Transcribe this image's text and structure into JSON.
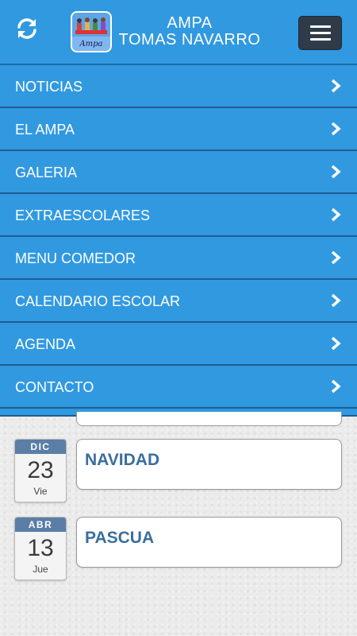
{
  "header": {
    "title_line1": "AMPA",
    "title_line2": "TOMAS NAVARRO",
    "logo_text": "Ampa",
    "refresh_icon": "refresh-icon",
    "menu_icon": "hamburger-icon"
  },
  "menu": {
    "items": [
      {
        "label": "NOTICIAS"
      },
      {
        "label": "EL AMPA"
      },
      {
        "label": "GALERIA"
      },
      {
        "label": "EXTRAESCOLARES"
      },
      {
        "label": "MENU COMEDOR"
      },
      {
        "label": "CALENDARIO ESCOLAR"
      },
      {
        "label": "AGENDA"
      },
      {
        "label": "CONTACTO"
      }
    ]
  },
  "events": [
    {
      "month": "DIC",
      "day": "23",
      "weekday": "Vie",
      "title": "NAVIDAD"
    },
    {
      "month": "ABR",
      "day": "13",
      "weekday": "Jue",
      "title": "PASCUA"
    }
  ],
  "colors": {
    "primary": "#3199e0",
    "menu_button": "#2f3b49",
    "date_header": "#5a7ea6",
    "event_title": "#3a6e9e"
  }
}
